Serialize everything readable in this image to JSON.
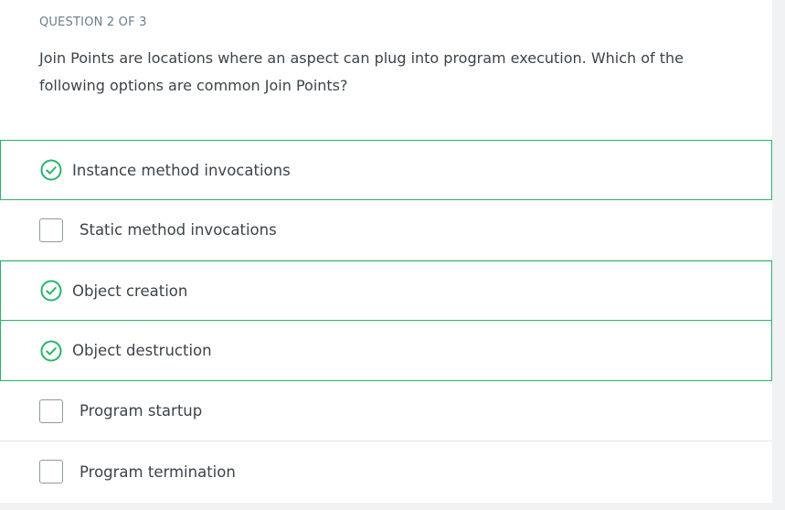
{
  "question": {
    "counter": "QUESTION 2 OF 3",
    "text": "Join Points are locations where an aspect can plug into program execution. Which of the following options are common Join Points?"
  },
  "options": [
    {
      "label": "Instance method invocations",
      "state": "correct",
      "icon": "check-circle-icon"
    },
    {
      "label": "Static method invocations",
      "state": "unselected",
      "icon": "checkbox-icon"
    },
    {
      "label": "Object creation",
      "state": "correct",
      "icon": "check-circle-icon"
    },
    {
      "label": "Object destruction",
      "state": "correct",
      "icon": "check-circle-icon"
    },
    {
      "label": "Program startup",
      "state": "unselected",
      "icon": "checkbox-icon"
    },
    {
      "label": "Program termination",
      "state": "unselected",
      "icon": "checkbox-icon"
    }
  ],
  "colors": {
    "correct": "#2ab46a",
    "text": "#3c4349",
    "muted": "#6b7d8c"
  }
}
